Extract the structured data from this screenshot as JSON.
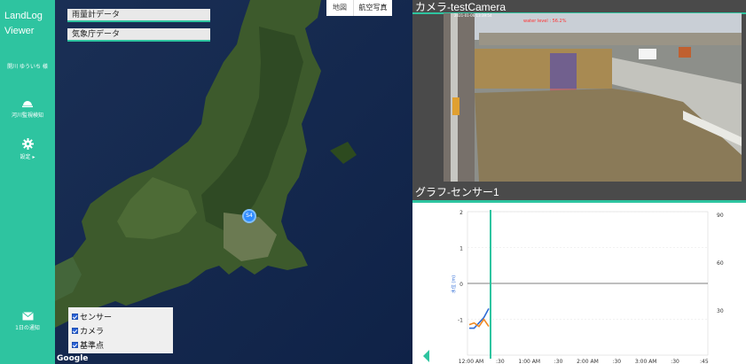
{
  "sidebar": {
    "brand_line1": "LandLog",
    "brand_line2": "Viewer",
    "user": "開川 ゆういち 様",
    "items": [
      {
        "label": "河川監視検知",
        "icon": "dome-icon"
      },
      {
        "label": "設定 ▸",
        "icon": "gear-icon"
      },
      {
        "label": "1日の通知",
        "icon": "mail-icon"
      }
    ]
  },
  "map": {
    "chip1": "雨量計データ",
    "chip2": "気象庁データ",
    "type_map": "地図",
    "type_satellite": "航空写真",
    "layers": [
      "センサー",
      "カメラ",
      "基準点"
    ],
    "attribution": "Google",
    "marker_label": "S4"
  },
  "camera": {
    "title": "カメラ-testCamera",
    "timestamp": "2021-01-06 13:39:54",
    "water_level": "water level : 56.2%"
  },
  "graph": {
    "title": "グラフ-センサー1"
  },
  "chart_data": {
    "type": "line",
    "ylabel": "水位 (m)",
    "y_left_ticks": [
      "2",
      "1",
      "0",
      "-1"
    ],
    "y_right_ticks": [
      "90",
      "60",
      "30"
    ],
    "x_ticks": [
      "12:00 AM",
      ":30",
      "1:00 AM",
      ":30",
      "2:00 AM",
      ":30",
      "3:00 AM",
      ":30",
      ":45"
    ],
    "ylim": [
      -2,
      2
    ],
    "series": [
      {
        "color": "#2e6bd6",
        "x": [
          0,
          1,
          2,
          3,
          4
        ],
        "y": [
          -1.25,
          -1.25,
          -1.1,
          -0.95,
          -0.7
        ]
      },
      {
        "color": "#f08a24",
        "x": [
          0,
          1,
          2,
          3,
          4
        ],
        "y": [
          -1.15,
          -1.1,
          -1.2,
          -1.0,
          -1.2
        ]
      }
    ],
    "cursor_color": "#2ec4a0"
  }
}
